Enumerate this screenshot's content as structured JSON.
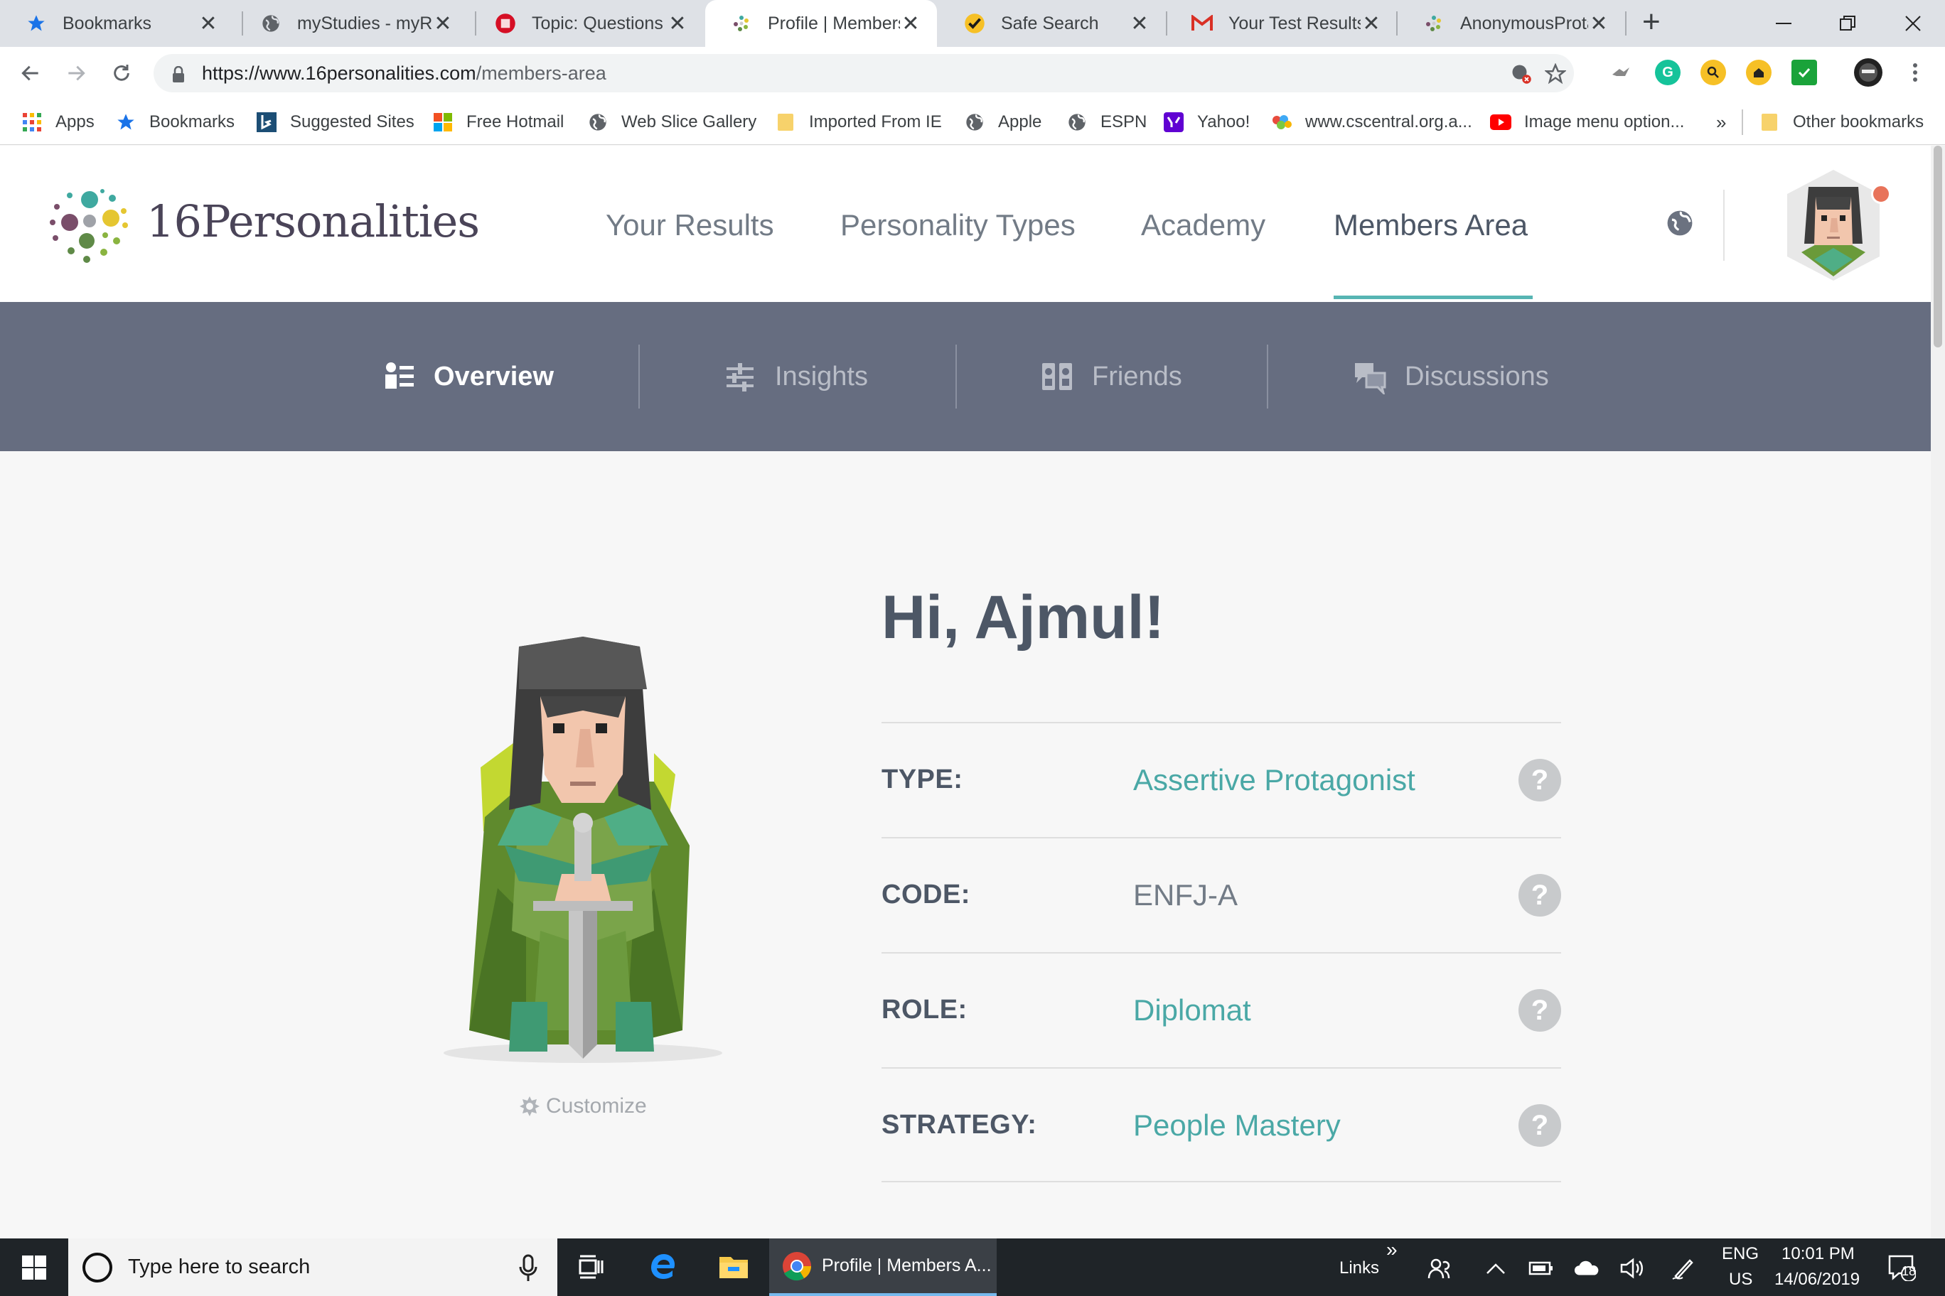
{
  "browser": {
    "tabs": [
      {
        "label": "Bookmarks",
        "favicon": "star-icon"
      },
      {
        "label": "myStudies - myRM",
        "favicon": "globe-icon"
      },
      {
        "label": "Topic: Questions o",
        "favicon": "puzzle-icon"
      },
      {
        "label": "Profile | Members",
        "favicon": "16p-logo-icon",
        "active": true
      },
      {
        "label": "Safe Search",
        "favicon": "check-icon"
      },
      {
        "label": "Your Test Results -",
        "favicon": "gmail-icon"
      },
      {
        "label": "AnonymousProtag",
        "favicon": "16p-logo-icon"
      }
    ],
    "close_glyph": "✕",
    "new_tab_glyph": "+",
    "url_host": "https://www.16personalities.com",
    "url_path": "/members-area",
    "bookmarks": [
      {
        "label": "Apps",
        "icon": "apps-grid-icon"
      },
      {
        "label": "Bookmarks",
        "icon": "star-icon"
      },
      {
        "label": "Suggested Sites",
        "icon": "bing-icon"
      },
      {
        "label": "Free Hotmail",
        "icon": "windows-logo-icon"
      },
      {
        "label": "Web Slice Gallery",
        "icon": "globe-icon"
      },
      {
        "label": "Imported From IE",
        "icon": "folder-icon"
      },
      {
        "label": "Apple",
        "icon": "globe-icon"
      },
      {
        "label": "ESPN",
        "icon": "globe-icon"
      },
      {
        "label": "Yahoo!",
        "icon": "yahoo-icon"
      },
      {
        "label": "www.cscentral.org.a...",
        "icon": "colorful-icon"
      },
      {
        "label": "Image menu option...",
        "icon": "youtube-icon"
      }
    ],
    "more_bookmarks": "»",
    "other_bookmarks": "Other bookmarks"
  },
  "site": {
    "logo_text": "16Personalities",
    "logo_num": "16",
    "logo_word": "Personalities",
    "nav": [
      "Your Results",
      "Personality Types",
      "Academy",
      "Members Area"
    ],
    "active_nav": "Members Area",
    "subnav": [
      {
        "label": "Overview",
        "icon": "overview-icon",
        "active": true
      },
      {
        "label": "Insights",
        "icon": "insights-icon"
      },
      {
        "label": "Friends",
        "icon": "friends-icon"
      },
      {
        "label": "Discussions",
        "icon": "discussions-icon"
      }
    ]
  },
  "profile": {
    "greeting": "Hi, Ajmul!",
    "customize_label": "Customize",
    "rows": [
      {
        "label": "TYPE:",
        "value": "Assertive Protagonist"
      },
      {
        "label": "CODE:",
        "value": "ENFJ-A"
      },
      {
        "label": "ROLE:",
        "value": "Diplomat"
      },
      {
        "label": "STRATEGY:",
        "value": "People Mastery"
      }
    ],
    "help_glyph": "?"
  },
  "taskbar": {
    "search_placeholder": "Type here to search",
    "active_app_label": "Profile | Members A...",
    "links_label": "Links",
    "links_chevron": "»",
    "lang_top": "ENG",
    "lang_bottom": "US",
    "time": "10:01 PM",
    "date": "14/06/2019",
    "notification_count": "18"
  },
  "colors": {
    "accent_teal": "#4aa8a6",
    "subnav_bg": "#666d80",
    "heading": "#4d5766"
  }
}
